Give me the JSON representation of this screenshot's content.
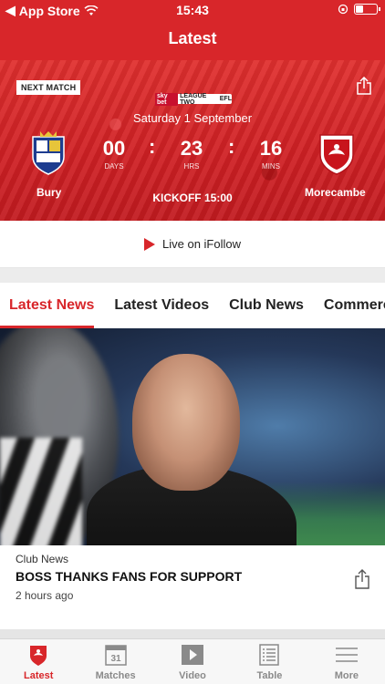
{
  "status_bar": {
    "carrier": "App Store",
    "time": "15:43"
  },
  "nav": {
    "title": "Latest"
  },
  "match": {
    "badge": "NEXT MATCH",
    "league_brand": "sky bet",
    "league_name": "LEAGUE TWO",
    "league_org": "EFL",
    "date": "Saturday 1 September",
    "home_team": "Bury",
    "away_team": "Morecambe",
    "countdown": {
      "days": "00",
      "days_label": "DAYS",
      "hrs": "23",
      "hrs_label": "HRS",
      "mins": "16",
      "mins_label": "MINS"
    },
    "kickoff": "KICKOFF 15:00"
  },
  "live": {
    "label": "Live on iFollow"
  },
  "tabs": [
    {
      "label": "Latest News",
      "active": true
    },
    {
      "label": "Latest Videos",
      "active": false
    },
    {
      "label": "Club News",
      "active": false
    },
    {
      "label": "Commercial",
      "active": false
    }
  ],
  "news": {
    "category": "Club News",
    "title": "BOSS THANKS FANS FOR SUPPORT",
    "time": "2 hours ago"
  },
  "tabbar": {
    "items": [
      {
        "label": "Latest",
        "icon": "club-crest-icon",
        "active": true
      },
      {
        "label": "Matches",
        "icon": "calendar-icon",
        "calendar_day": "31",
        "active": false
      },
      {
        "label": "Video",
        "icon": "play-icon",
        "active": false
      },
      {
        "label": "Table",
        "icon": "table-icon",
        "active": false
      },
      {
        "label": "More",
        "icon": "menu-icon",
        "active": false
      }
    ]
  },
  "colors": {
    "brand_red": "#d8262a",
    "tab_inactive": "#8a8a8a"
  }
}
